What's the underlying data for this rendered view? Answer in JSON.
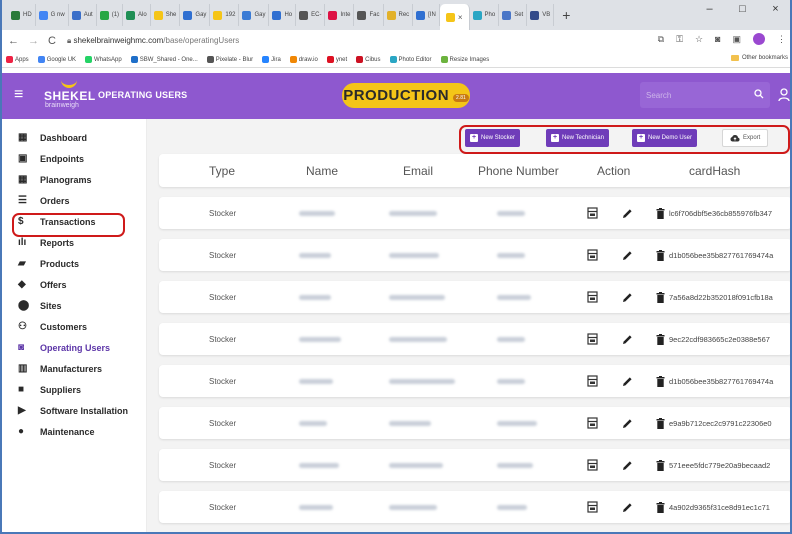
{
  "browser": {
    "tabs": [
      {
        "label": "HD",
        "color": "#2a7a3a"
      },
      {
        "label": "G nw",
        "color": "#4285f4"
      },
      {
        "label": "Aut",
        "color": "#3a6fc9"
      },
      {
        "label": "(1)",
        "color": "#28a745"
      },
      {
        "label": "Alo",
        "color": "#1f8f55"
      },
      {
        "label": "She",
        "color": "#f5c518"
      },
      {
        "label": "Gay",
        "color": "#2f6fd1"
      },
      {
        "label": "192",
        "color": "#f5c518"
      },
      {
        "label": "Gay",
        "color": "#3a7bd5"
      },
      {
        "label": "Ho",
        "color": "#2f6fd1"
      },
      {
        "label": "EC-",
        "color": "#555555"
      },
      {
        "label": "Inte",
        "color": "#d14"
      },
      {
        "label": "Fac",
        "color": "#555555"
      },
      {
        "label": "Rec",
        "color": "#e2b12a"
      },
      {
        "label": "[IN",
        "color": "#2f6fd1"
      },
      {
        "label": "",
        "color": "#f5c518",
        "active": true
      },
      {
        "label": "Pho",
        "color": "#2aa6c4"
      },
      {
        "label": "Set",
        "color": "#4a76c7"
      },
      {
        "label": "VB",
        "color": "#344b8a"
      }
    ],
    "new_tab": "+",
    "window_controls": [
      "–",
      "□",
      "×"
    ],
    "url_host": "shekelbrainweighmc.com",
    "url_path": "/base/operatingUsers",
    "bookmarks": [
      {
        "label": "Apps",
        "color": "#e24"
      },
      {
        "label": "Google UK",
        "color": "#4285f4"
      },
      {
        "label": "WhatsApp",
        "color": "#25d366"
      },
      {
        "label": "SBW_Shared - One...",
        "color": "#1f6fc9"
      },
      {
        "label": "Pixelate - Blur",
        "color": "#555555"
      },
      {
        "label": "Jira",
        "color": "#2684ff"
      },
      {
        "label": "draw.io",
        "color": "#f08705"
      },
      {
        "label": "ynet",
        "color": "#d12"
      },
      {
        "label": "Cibus",
        "color": "#c12"
      },
      {
        "label": "Photo Editor",
        "color": "#2aa6c4"
      },
      {
        "label": "Resize Images",
        "color": "#6cb33e"
      }
    ],
    "other_bookmarks": "Other bookmarks"
  },
  "header": {
    "logo_top": "SHEKEL",
    "logo_bottom": "brainweigh",
    "title": "OPERATING USERS",
    "env_badge": "PRODUCTION",
    "env_sub": "2.81",
    "search_placeholder": "Search",
    "brand_color": "#8e58cf",
    "badge_color": "#f4c518"
  },
  "sidebar": {
    "items": [
      {
        "label": "Dashboard",
        "icon": "dashboard-icon",
        "glyph": "▦"
      },
      {
        "label": "Endpoints",
        "icon": "endpoint-icon",
        "glyph": "▣"
      },
      {
        "label": "Planograms",
        "icon": "grid-icon",
        "glyph": "▦"
      },
      {
        "label": "Orders",
        "icon": "list-icon",
        "glyph": "☰"
      },
      {
        "label": "Transactions",
        "icon": "dollar-icon",
        "glyph": "$"
      },
      {
        "label": "Reports",
        "icon": "bar-chart-icon",
        "glyph": "ılı"
      },
      {
        "label": "Products",
        "icon": "cart-icon",
        "glyph": "▰"
      },
      {
        "label": "Offers",
        "icon": "tag-icon",
        "glyph": "◆"
      },
      {
        "label": "Sites",
        "icon": "location-pin-icon",
        "glyph": "⬤"
      },
      {
        "label": "Customers",
        "icon": "people-icon",
        "glyph": "⚇"
      },
      {
        "label": "Operating Users",
        "icon": "user-badge-icon",
        "glyph": "◙",
        "active": true
      },
      {
        "label": "Manufacturers",
        "icon": "factory-icon",
        "glyph": "▥"
      },
      {
        "label": "Suppliers",
        "icon": "truck-icon",
        "glyph": "■"
      },
      {
        "label": "Software Installation",
        "icon": "play-icon",
        "glyph": "▶"
      },
      {
        "label": "Maintenance",
        "icon": "info-icon",
        "glyph": "●"
      }
    ]
  },
  "toolbar": {
    "new_stocker": "New Stocker",
    "new_technician": "New Technician",
    "new_demo_user": "New Demo User",
    "export": "Export",
    "button_color": "#6f3cb9"
  },
  "table": {
    "columns": [
      "Type",
      "Name",
      "Email",
      "Phone Number",
      "Action",
      "cardHash"
    ],
    "rows": [
      {
        "type": "Stocker",
        "hash": "lc6f706dbf5e36cb855976fb347"
      },
      {
        "type": "Stocker",
        "hash": "d1b056bee35b827761769474a"
      },
      {
        "type": "Stocker",
        "hash": "7a56a8d22b352018f091cfb18a"
      },
      {
        "type": "Stocker",
        "hash": "9ec22cdf983665c2e0388e567"
      },
      {
        "type": "Stocker",
        "hash": "d1b056bee35b827761769474a"
      },
      {
        "type": "Stocker",
        "hash": "e9a9b712cec2c9791c22306e0"
      },
      {
        "type": "Stocker",
        "hash": "571eee5fdc779e20a9becaad2"
      },
      {
        "type": "Stocker",
        "hash": "4a902d9365f31ce8d91ec1c71"
      }
    ]
  }
}
